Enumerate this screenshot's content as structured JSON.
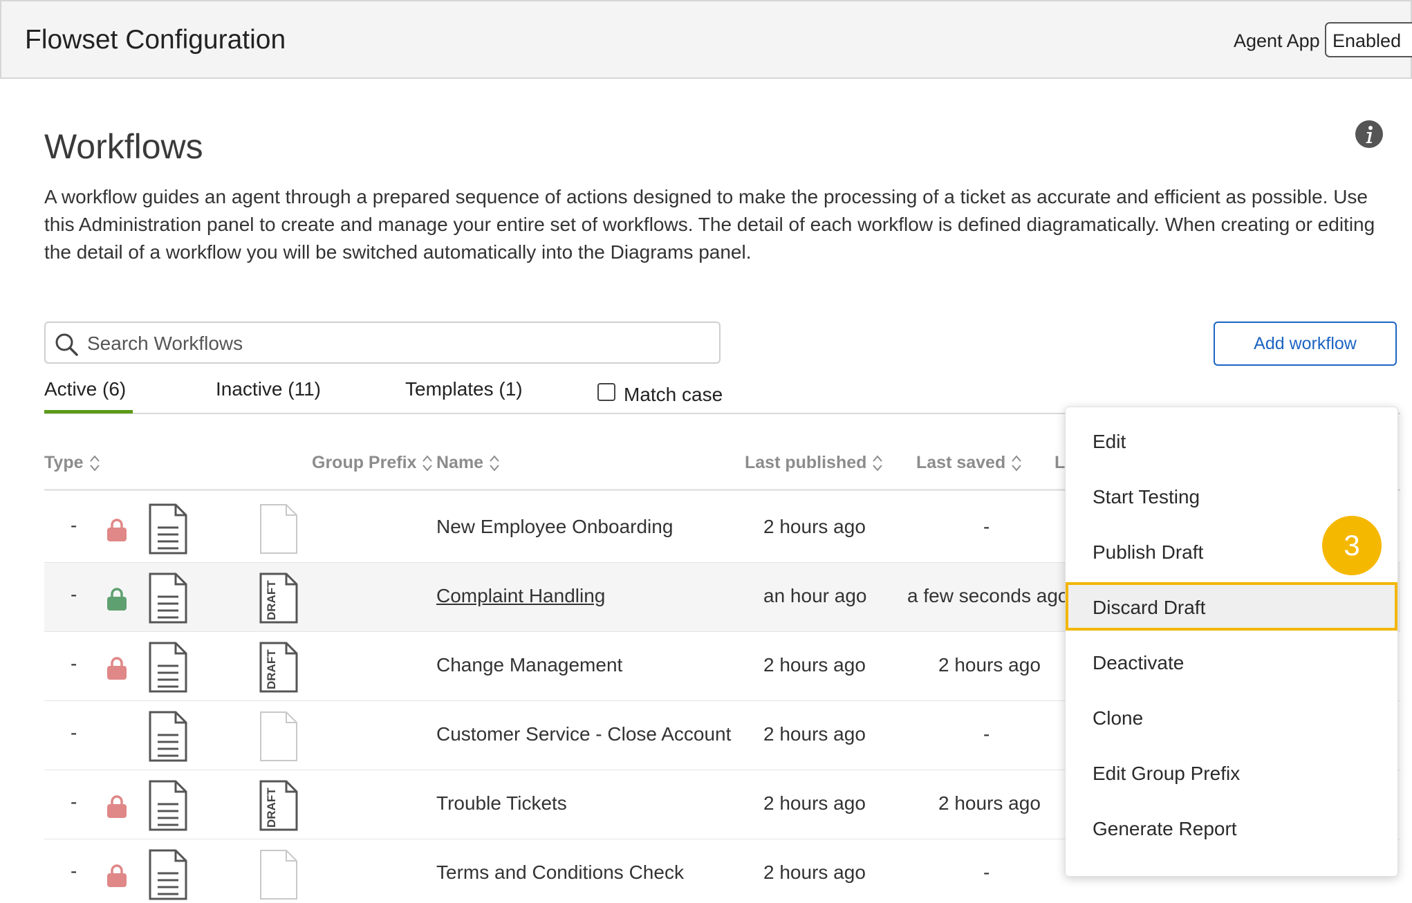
{
  "header": {
    "title": "Flowset Configuration",
    "agent_app_label": "Agent App",
    "agent_app_value": "Enabled"
  },
  "page": {
    "title": "Workflows",
    "description": "A workflow guides an agent through a prepared sequence of actions designed to make the processing of a ticket as accurate and efficient as possible. Use this Administration panel to create and manage your entire set of workflows. The detail of each workflow is defined diagramatically. When creating or editing the detail of a workflow you will be switched automatically into the Diagrams panel."
  },
  "search": {
    "placeholder": "Search Workflows",
    "value": ""
  },
  "add_button": "Add workflow",
  "tabs": [
    {
      "label": "Active (6)",
      "active": true
    },
    {
      "label": "Inactive (11)",
      "active": false
    },
    {
      "label": "Templates (1)",
      "active": false
    }
  ],
  "match_case": {
    "label": "Match case",
    "checked": false
  },
  "columns": {
    "type": "Type",
    "group_prefix": "Group Prefix",
    "name": "Name",
    "last_published": "Last published",
    "last_saved": "Last saved",
    "truncated": "L"
  },
  "rows": [
    {
      "type": "-",
      "lock": "locked",
      "draft": false,
      "name": "New Employee Onboarding",
      "link": false,
      "last_published": "2 hours ago",
      "last_saved": "-"
    },
    {
      "type": "-",
      "lock": "unlocked",
      "draft": true,
      "name": "Complaint Handling",
      "link": true,
      "last_published": "an hour ago",
      "last_saved": "a few seconds ago"
    },
    {
      "type": "-",
      "lock": "locked",
      "draft": true,
      "name": "Change Management",
      "link": false,
      "last_published": "2 hours ago",
      "last_saved": "2 hours ago"
    },
    {
      "type": "-",
      "lock": "none",
      "draft": false,
      "name": "Customer Service - Close Account",
      "link": false,
      "last_published": "2 hours ago",
      "last_saved": "-"
    },
    {
      "type": "-",
      "lock": "locked",
      "draft": true,
      "name": "Trouble Tickets",
      "link": false,
      "last_published": "2 hours ago",
      "last_saved": "2 hours ago"
    },
    {
      "type": "-",
      "lock": "locked",
      "draft": false,
      "name": "Terms and Conditions Check",
      "link": false,
      "last_published": "2 hours ago",
      "last_saved": "-"
    }
  ],
  "draft_stamp": "DRAFT",
  "context_menu": {
    "items": [
      "Edit",
      "Start Testing",
      "Publish Draft",
      "Discard Draft",
      "Deactivate",
      "Clone",
      "Edit Group Prefix",
      "Generate Report"
    ],
    "highlighted": "Discard Draft"
  },
  "step_badge": "3",
  "colors": {
    "lock_locked": "#e08787",
    "lock_unlocked": "#5fa070",
    "accent_blue": "#1c64c2",
    "tab_underline": "#5b9a17",
    "highlight": "#f2b705",
    "badge": "#f5b800"
  }
}
